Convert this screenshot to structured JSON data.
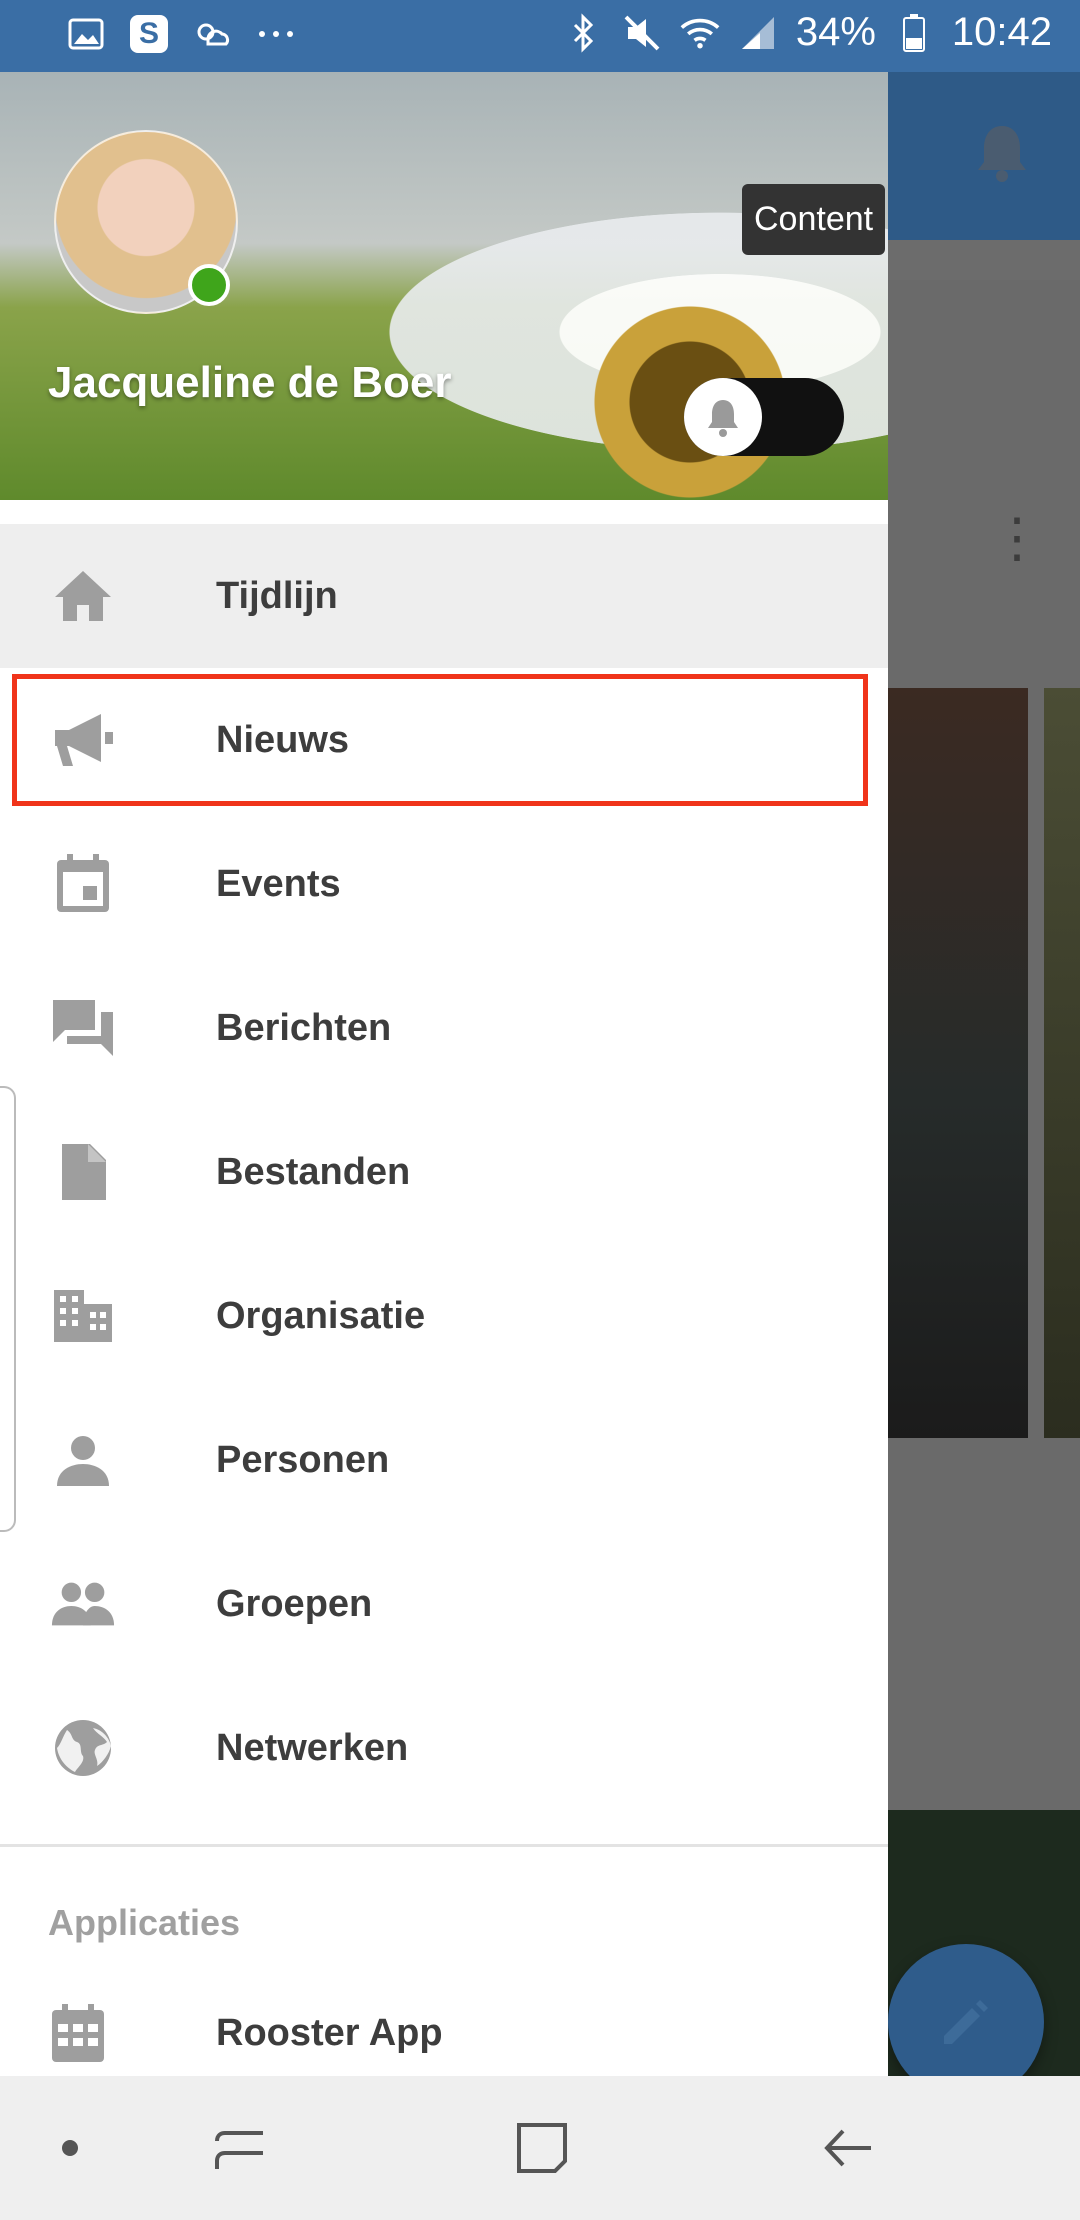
{
  "status_bar": {
    "battery": "34%",
    "time": "10:42",
    "left_icons": [
      "image-icon",
      "s-app-icon",
      "weather-icon",
      "more-notifications-icon"
    ],
    "right_icons": [
      "bluetooth-icon",
      "mute-icon",
      "wifi-icon",
      "signal-icon",
      "battery-icon"
    ]
  },
  "drawer": {
    "username": "Jacqueline de Boer",
    "menu": [
      {
        "label": "Tijdlijn",
        "icon": "home-icon",
        "active": true
      },
      {
        "label": "Nieuws",
        "icon": "megaphone-icon",
        "highlighted": true
      },
      {
        "label": "Events",
        "icon": "calendar-icon"
      },
      {
        "label": "Berichten",
        "icon": "chat-icon"
      },
      {
        "label": "Bestanden",
        "icon": "file-icon"
      },
      {
        "label": "Organisatie",
        "icon": "building-icon"
      },
      {
        "label": "Personen",
        "icon": "person-icon"
      },
      {
        "label": "Groepen",
        "icon": "group-icon"
      },
      {
        "label": "Netwerken",
        "icon": "globe-icon"
      }
    ],
    "section_title": "Applicaties",
    "apps": [
      {
        "label": "Rooster App",
        "icon": "calendar-grid-icon"
      }
    ]
  },
  "background": {
    "tooltip": "Content"
  },
  "colors": {
    "status_bar": "#3a6ea5",
    "highlight_border": "#f0341a",
    "online": "#3fa51b",
    "fab": "#2f5c8b"
  }
}
